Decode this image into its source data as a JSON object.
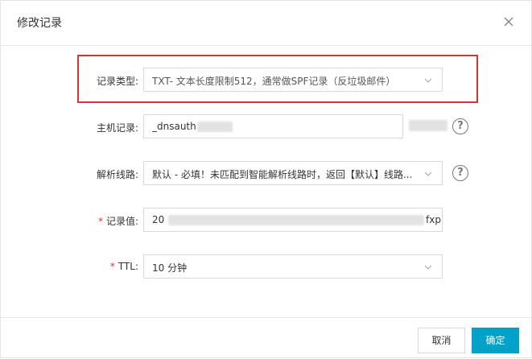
{
  "dialog": {
    "title": "修改记录",
    "close_icon": "close-icon"
  },
  "form": {
    "record_type": {
      "label": "记录类型:",
      "value": "TXT- 文本长度限制512，通常做SPF记录（反垃圾邮件）"
    },
    "host_record": {
      "label": "主机记录:",
      "value": "_dnsauth"
    },
    "resolution_line": {
      "label": "解析线路:",
      "value": "默认 - 必填！未匹配到智能解析线路时，返回【默认】线路..."
    },
    "record_value": {
      "required_mark": "*",
      "label": "记录值:",
      "value_start": "20",
      "value_end": "fxp"
    },
    "ttl": {
      "required_mark": "*",
      "label": "TTL:",
      "value": "10 分钟"
    }
  },
  "footer": {
    "cancel_label": "取消",
    "ok_label": "确定"
  },
  "colors": {
    "highlight": "#e03131",
    "primary": "#00a2ca"
  }
}
